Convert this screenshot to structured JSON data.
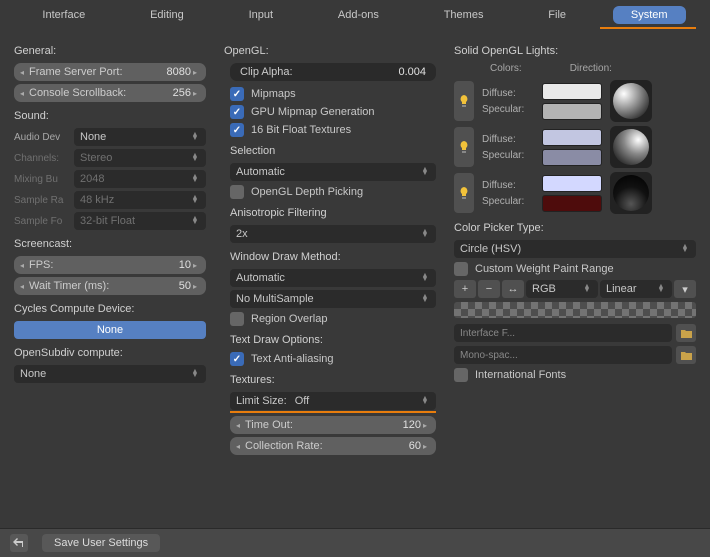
{
  "tabs": [
    "Interface",
    "Editing",
    "Input",
    "Add-ons",
    "Themes",
    "File",
    "System"
  ],
  "active_tab": "System",
  "col1": {
    "general": "General:",
    "frame_port_label": "Frame Server Port:",
    "frame_port_val": "8080",
    "scrollback_label": "Console Scrollback:",
    "scrollback_val": "256",
    "sound": "Sound:",
    "audio_dev_label": "Audio Dev",
    "audio_dev_val": "None",
    "channels_label": "Channels:",
    "channels_val": "Stereo",
    "mixing_label": "Mixing Bu",
    "mixing_val": "2048",
    "sample_ra_label": "Sample Ra",
    "sample_ra_val": "48 kHz",
    "sample_fo_label": "Sample Fo",
    "sample_fo_val": "32-bit Float",
    "screencast": "Screencast:",
    "fps_label": "FPS:",
    "fps_val": "10",
    "wait_label": "Wait Timer (ms):",
    "wait_val": "50",
    "cycles": "Cycles Compute Device:",
    "cycles_val": "None",
    "osd": "OpenSubdiv compute:",
    "osd_val": "None"
  },
  "col2": {
    "opengl": "OpenGL:",
    "clip_label": "Clip Alpha:",
    "clip_val": "0.004",
    "mipmaps": "Mipmaps",
    "gpu_mip": "GPU Mipmap Generation",
    "float16": "16 Bit Float Textures",
    "selection": "Selection",
    "sel_val": "Automatic",
    "depth_pick": "OpenGL Depth Picking",
    "aniso": "Anisotropic Filtering",
    "aniso_val": "2x",
    "wdm": "Window Draw Method:",
    "wdm_val": "Automatic",
    "multisample": "No MultiSample",
    "region_overlap": "Region Overlap",
    "tdo": "Text Draw Options:",
    "text_aa": "Text Anti-aliasing",
    "textures": "Textures:",
    "limit_label": "Limit Size:",
    "limit_val": "Off",
    "timeout_label": "Time Out:",
    "timeout_val": "120",
    "collect_label": "Collection Rate:",
    "collect_val": "60"
  },
  "col3": {
    "solid_lights": "Solid OpenGL Lights:",
    "colors_hdr": "Colors:",
    "direction_hdr": "Direction:",
    "diffuse": "Diffuse:",
    "specular": "Specular:",
    "light_colors": [
      {
        "diff": "#e9e9e9",
        "spec": "#b3b3b3"
      },
      {
        "diff": "#c2c6e1",
        "spec": "#8a8ca5"
      },
      {
        "diff": "#d3d8ff",
        "spec": "#4e0c0c"
      }
    ],
    "cpt": "Color Picker Type:",
    "cpt_val": "Circle (HSV)",
    "cwpr": "Custom Weight Paint Range",
    "rgb": "RGB",
    "linear": "Linear",
    "iface_font": "Interface F...",
    "mono_font": "Mono-spac...",
    "intl_fonts": "International Fonts"
  },
  "footer": {
    "save": "Save User Settings"
  }
}
